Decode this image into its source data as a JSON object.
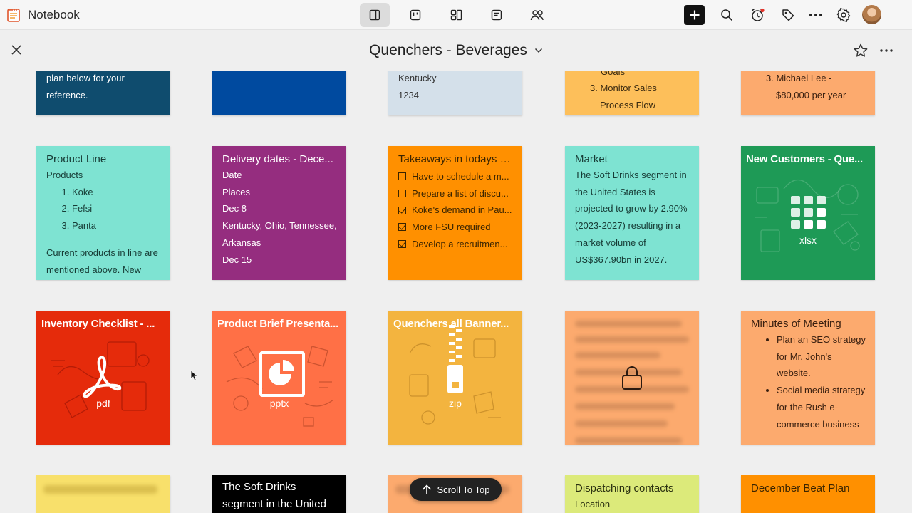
{
  "app": {
    "name": "Notebook"
  },
  "notebook": {
    "title": "Quenchers - Beverages"
  },
  "colors": {
    "teal_dark": "#0f4c6e",
    "blue": "#004a9f",
    "grey_blue": "#d4e0ea",
    "amber": "#fdbf5a",
    "peach": "#fcaa6e",
    "aqua": "#7ee3d2",
    "purple": "#952d7f",
    "orange": "#ff9000",
    "green": "#1e9a56",
    "red": "#e52b0b",
    "coral": "#ff7046",
    "gold": "#f3b43f",
    "yellow": "#f8e06b",
    "black": "#000000",
    "lime": "#dcea7a"
  },
  "row1": {
    "c1": {
      "line1": "plan below for your",
      "line2": "reference."
    },
    "c3": {
      "line1": "Kentucky",
      "line2": "1234"
    },
    "c4": {
      "line1": "Goals",
      "line2": "3. Monitor Sales",
      "line3": "Process Flow"
    },
    "c5": {
      "line1": "3. Michael Lee -",
      "line2": "$80,000 per year"
    }
  },
  "row2": {
    "product_line": {
      "title": "Product Line",
      "label": "Products",
      "items": [
        "Koke",
        "Fefsi",
        "Panta"
      ],
      "footer1": "Current products in line are",
      "footer2": "mentioned above. New"
    },
    "delivery": {
      "title": "Delivery dates - Dece...",
      "lines": [
        "Date",
        "Places",
        "Dec 8",
        "Kentucky, Ohio, Tennessee,",
        "Arkansas",
        "Dec 15"
      ]
    },
    "takeaways": {
      "title": "Takeaways in todays M...",
      "items": [
        {
          "text": "Have to schedule a m...",
          "checked": false
        },
        {
          "text": "Prepare a list of discu...",
          "checked": false
        },
        {
          "text": "Koke's demand in Pau...",
          "checked": true
        },
        {
          "text": "More FSU required",
          "checked": true
        },
        {
          "text": "Develop a recruitmen...",
          "checked": true
        }
      ]
    },
    "market": {
      "title": "Market",
      "lines": [
        "The Soft Drinks segment in",
        "the United States is",
        "projected to grow by 2.90%",
        "(2023-2027) resulting in a",
        "market volume of",
        "US$367.90bn in 2027."
      ]
    },
    "customers": {
      "title": "New Customers - Que...",
      "ext": "xlsx"
    }
  },
  "row3": {
    "inventory": {
      "title": "Inventory Checklist - ...",
      "ext": "pdf"
    },
    "brief": {
      "title": "Product Brief Presenta...",
      "ext": "pptx"
    },
    "banner": {
      "title": "Quenchers all Banner...",
      "ext": "zip"
    },
    "minutes": {
      "title": "Minutes of Meeting",
      "bullet1": [
        "Plan an SEO strategy",
        "for Mr. John's",
        "website."
      ],
      "bullet2": [
        "Social media strategy",
        "for the Rush e-",
        "commerce business"
      ]
    }
  },
  "row4": {
    "soft_drinks": {
      "line1": "The Soft Drinks",
      "line2": "segment in the United"
    },
    "dispatch": {
      "title": "Dispatching contacts",
      "line1": "Location"
    },
    "beat": {
      "title": "December Beat Plan"
    }
  },
  "scroll_top": {
    "label": "Scroll To Top"
  }
}
